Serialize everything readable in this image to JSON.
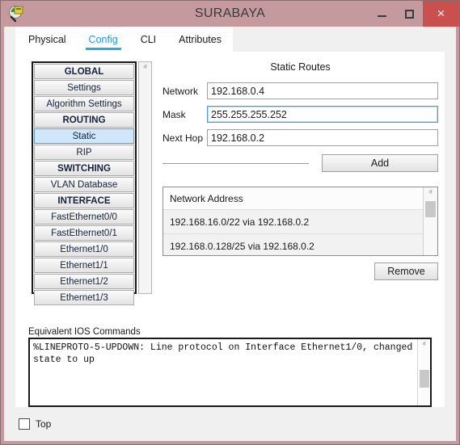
{
  "window": {
    "title": "SURABAYA",
    "app_icon": "packet-tracer-magnifier-icon",
    "controls": {
      "minimize": "minimize-icon",
      "maximize": "maximize-icon",
      "close": "×"
    },
    "colors": {
      "titlebar": "#c49a9e",
      "close_button": "#c9504f",
      "accent": "#29abe2",
      "selection": "#cfe6fb"
    }
  },
  "tabs": [
    {
      "label": "Physical",
      "active": false
    },
    {
      "label": "Config",
      "active": true
    },
    {
      "label": "CLI",
      "active": false
    },
    {
      "label": "Attributes",
      "active": false
    }
  ],
  "sidebar": {
    "items": [
      {
        "label": "GLOBAL",
        "type": "header",
        "selected": false
      },
      {
        "label": "Settings",
        "type": "item",
        "selected": false
      },
      {
        "label": "Algorithm Settings",
        "type": "item",
        "selected": false
      },
      {
        "label": "ROUTING",
        "type": "header",
        "selected": false
      },
      {
        "label": "Static",
        "type": "item",
        "selected": true
      },
      {
        "label": "RIP",
        "type": "item",
        "selected": false
      },
      {
        "label": "SWITCHING",
        "type": "header",
        "selected": false
      },
      {
        "label": "VLAN Database",
        "type": "item",
        "selected": false
      },
      {
        "label": "INTERFACE",
        "type": "header",
        "selected": false
      },
      {
        "label": "FastEthernet0/0",
        "type": "item",
        "selected": false
      },
      {
        "label": "FastEthernet0/1",
        "type": "item",
        "selected": false
      },
      {
        "label": "Ethernet1/0",
        "type": "item",
        "selected": false
      },
      {
        "label": "Ethernet1/1",
        "type": "item",
        "selected": false
      },
      {
        "label": "Ethernet1/2",
        "type": "item",
        "selected": false
      },
      {
        "label": "Ethernet1/3",
        "type": "item",
        "selected": false
      }
    ],
    "scrollbar": {
      "up_arrow": "ⱏ",
      "down_arrow": "ⱟ"
    }
  },
  "static_routes": {
    "heading": "Static Routes",
    "fields": [
      {
        "label": "Network",
        "value": "192.168.0.4",
        "placeholder": "",
        "focused": false
      },
      {
        "label": "Mask",
        "value": "255.255.255.252",
        "placeholder": "",
        "focused": true
      },
      {
        "label": "Next Hop",
        "value": "192.168.0.2",
        "placeholder": "",
        "focused": false
      }
    ],
    "add_button": "Add",
    "remove_button": "Remove",
    "list": {
      "header": "Network Address",
      "rows": [
        "192.168.16.0/22 via 192.168.0.2",
        "192.168.0.128/25 via 192.168.0.2"
      ]
    }
  },
  "ios_commands": {
    "label": "Equivalent IOS Commands",
    "text": "%LINEPROTO-5-UPDOWN: Line protocol on Interface Ethernet1/0, changed state to up"
  },
  "bottom": {
    "top_checkbox_label": "Top",
    "top_checkbox_checked": false
  }
}
